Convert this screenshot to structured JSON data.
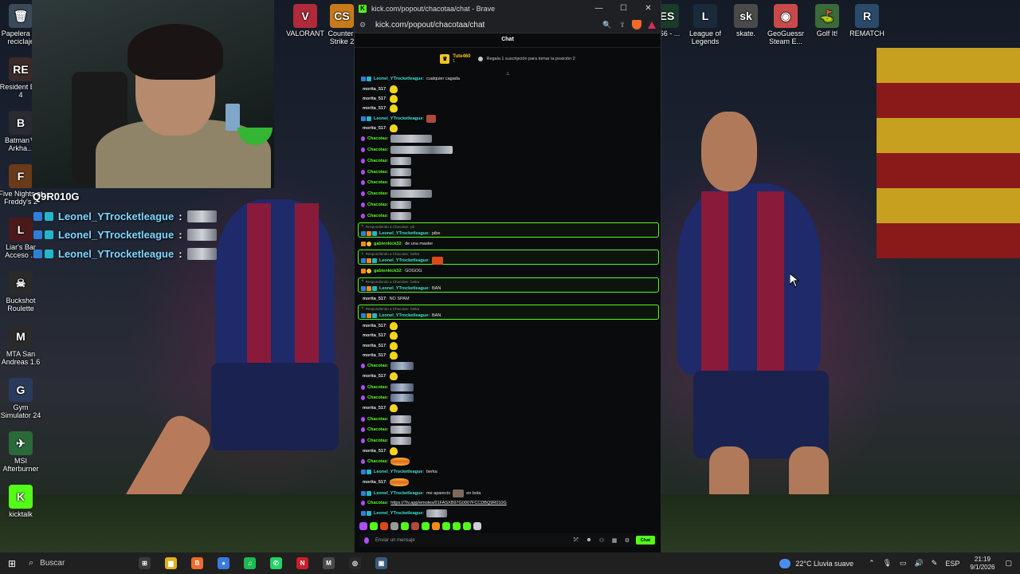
{
  "browser": {
    "title": "kick.com/popout/chacotaa/chat - Brave",
    "url": "kick.com/popout/chacotaa/chat",
    "window_buttons": [
      "—",
      "☐",
      "✕"
    ]
  },
  "chat": {
    "header": "Chat",
    "pinned": {
      "top_user": "Tute460",
      "top_count": "1",
      "info": "Regala 1 suscripción para tomar la posición 2"
    },
    "input_placeholder": "Enviar un mensaje",
    "send_label": "Chat",
    "reply_prefix": "Respondiendo a Chacotas:",
    "messages": [
      {
        "kind": "msg",
        "user": "Leonel_YTrocketleague",
        "badges": [
          "blue",
          "teal"
        ],
        "text": "cualquier cagada",
        "emote": ""
      },
      {
        "kind": "msg",
        "user": "morita_517",
        "badges": [],
        "text": "",
        "emote": "em-y"
      },
      {
        "kind": "msg",
        "user": "morita_517",
        "badges": [],
        "text": "",
        "emote": "em-y"
      },
      {
        "kind": "msg",
        "user": "morita_517",
        "badges": [],
        "text": "",
        "emote": "em-y"
      },
      {
        "kind": "msg",
        "user": "Leonel_YTrocketleague",
        "badges": [
          "blue",
          "teal"
        ],
        "text": "",
        "emote": "em-r"
      },
      {
        "kind": "msg",
        "user": "morita_517",
        "badges": [],
        "text": "",
        "emote": "em-y"
      },
      {
        "kind": "msg",
        "user": "Chacotas",
        "badges": [
          "purple"
        ],
        "text": "",
        "emote": "em-gm"
      },
      {
        "kind": "msg",
        "user": "Chacotas",
        "badges": [
          "purple"
        ],
        "text": "",
        "emote": "em-gw"
      },
      {
        "kind": "msg",
        "user": "Chacotas",
        "badges": [
          "purple"
        ],
        "text": "",
        "emote": "em-g"
      },
      {
        "kind": "msg",
        "user": "Chacotas",
        "badges": [
          "purple"
        ],
        "text": "",
        "emote": "em-g"
      },
      {
        "kind": "msg",
        "user": "Chacotas",
        "badges": [
          "purple"
        ],
        "text": "",
        "emote": "em-g"
      },
      {
        "kind": "msg",
        "user": "Chacotas",
        "badges": [
          "purple"
        ],
        "text": "",
        "emote": "em-gm"
      },
      {
        "kind": "msg",
        "user": "Chacotas",
        "badges": [
          "purple"
        ],
        "text": "",
        "emote": "em-g"
      },
      {
        "kind": "msg",
        "user": "Chacotas",
        "badges": [
          "purple"
        ],
        "text": "",
        "emote": "em-g"
      },
      {
        "kind": "reply",
        "ref": "pb",
        "user": "Leonel_YTrocketleague",
        "badges": [
          "blue",
          "orange",
          "teal"
        ],
        "text": "pibe",
        "emote": ""
      },
      {
        "kind": "msg",
        "user": "gabienkick32",
        "badges": [
          "orange",
          "yellow"
        ],
        "text": "de una master",
        "emote": ""
      },
      {
        "kind": "reply",
        "ref": "betka",
        "user": "Leonel_YTrocketleague",
        "badges": [
          "blue",
          "orange",
          "teal"
        ],
        "text": "",
        "emote": "em-fire"
      },
      {
        "kind": "msg",
        "user": "gabienkick32",
        "badges": [
          "orange",
          "yellow"
        ],
        "text": "GOGOG",
        "emote": ""
      },
      {
        "kind": "reply",
        "ref": "betka",
        "user": "Leonel_YTrocketleague",
        "badges": [
          "blue",
          "orange",
          "teal"
        ],
        "text": "BAN",
        "emote": ""
      },
      {
        "kind": "msg",
        "user": "morita_517",
        "badges": [],
        "text": "NO SPAM",
        "emote": ""
      },
      {
        "kind": "reply",
        "ref": "betka",
        "user": "Leonel_YTrocketleague",
        "badges": [
          "blue",
          "orange",
          "teal"
        ],
        "text": "BAN",
        "emote": ""
      },
      {
        "kind": "msg",
        "user": "morita_517",
        "badges": [],
        "text": "",
        "emote": "em-y"
      },
      {
        "kind": "msg",
        "user": "morita_517",
        "badges": [],
        "text": "",
        "emote": "em-y"
      },
      {
        "kind": "msg",
        "user": "morita_517",
        "badges": [],
        "text": "",
        "emote": "em-y"
      },
      {
        "kind": "msg",
        "user": "morita_517",
        "badges": [],
        "text": "",
        "emote": "em-y"
      },
      {
        "kind": "msg",
        "user": "Chacotas",
        "badges": [
          "purple"
        ],
        "text": "",
        "emote": "em-b"
      },
      {
        "kind": "msg",
        "user": "morita_517",
        "badges": [],
        "text": "",
        "emote": "em-y"
      },
      {
        "kind": "msg",
        "user": "Chacotas",
        "badges": [
          "purple"
        ],
        "text": "",
        "emote": "em-b"
      },
      {
        "kind": "msg",
        "user": "Chacotas",
        "badges": [
          "purple"
        ],
        "text": "",
        "emote": "em-b"
      },
      {
        "kind": "msg",
        "user": "morita_517",
        "badges": [],
        "text": "",
        "emote": "em-y"
      },
      {
        "kind": "msg",
        "user": "Chacotas",
        "badges": [
          "purple"
        ],
        "text": "",
        "emote": "em-g"
      },
      {
        "kind": "msg",
        "user": "Chacotas",
        "badges": [
          "purple"
        ],
        "text": "",
        "emote": "em-g"
      },
      {
        "kind": "msg",
        "user": "Chacotas",
        "badges": [
          "purple"
        ],
        "text": "",
        "emote": "em-g"
      },
      {
        "kind": "msg",
        "user": "morita_517",
        "badges": [],
        "text": "",
        "emote": "em-y"
      },
      {
        "kind": "msg",
        "user": "Chacotas",
        "badges": [
          "purple"
        ],
        "text": "",
        "emote": "em-burger"
      },
      {
        "kind": "msg",
        "user": "Leonel_YTrocketleague",
        "badges": [
          "blue",
          "teal"
        ],
        "text": "berka",
        "emote": ""
      },
      {
        "kind": "msg",
        "user": "morita_517",
        "badges": [],
        "text": "",
        "emote": "em-burger"
      },
      {
        "kind": "msg",
        "user": "Leonel_YTrocketleague",
        "badges": [
          "blue",
          "teal"
        ],
        "text": "me aparecio",
        "emote": "em-cat",
        "text2": "en bola"
      },
      {
        "kind": "msg",
        "user": "Chacotas",
        "badges": [
          "purple"
        ],
        "text": "",
        "emote": "",
        "link": "https://7tv.app/emotes/01FASXB97G0007FCCDBQ9R010G"
      },
      {
        "kind": "msg",
        "user": "Leonel_YTrocketleague",
        "badges": [
          "blue",
          "teal"
        ],
        "text": "",
        "emote": "em-g"
      },
      {
        "kind": "msg",
        "user": "Leonel_YTrocketleague",
        "badges": [
          "blue",
          "teal"
        ],
        "text": "",
        "emote": "em-g"
      },
      {
        "kind": "msg",
        "user": "Leonel_YTrocketleague",
        "badges": [
          "blue",
          "teal"
        ],
        "text": "",
        "emote": "em-g"
      }
    ],
    "emote_bar_colors": [
      "#b14cff",
      "#53fc18",
      "#d94a1a",
      "#9a9a9a",
      "#53fc18",
      "#b04a3a",
      "#53fc18",
      "#f28a1a",
      "#53fc18",
      "#53fc18",
      "#53fc18",
      "#cfcfcf"
    ]
  },
  "overlay": {
    "name": "Q9R010G",
    "lines": [
      {
        "user": "Leonel_YTrocketleague",
        "colon": ":"
      },
      {
        "user": "Leonel_YTrocketleague",
        "colon": ":"
      },
      {
        "user": "Leonel_YTrocketleague",
        "colon": ":"
      }
    ]
  },
  "desktop_icons": [
    {
      "label": "Papelera de reciclaje",
      "glyph": "🗑",
      "color": "#3a4a5a",
      "col": 0,
      "row": 0
    },
    {
      "label": "Resident Evil 4",
      "glyph": "RE",
      "color": "#3a2a2a",
      "col": 0,
      "row": 1
    },
    {
      "label": "Batman™ Arkha...",
      "glyph": "B",
      "color": "#2a2a33",
      "col": 0,
      "row": 2
    },
    {
      "label": "Five Nights at Freddy's 2",
      "glyph": "F",
      "color": "#6a3a1a",
      "col": 0,
      "row": 3
    },
    {
      "label": "Liar's Bar Acceso ...",
      "glyph": "L",
      "color": "#4a1a1a",
      "col": 0,
      "row": 4
    },
    {
      "label": "Buckshot Roulette",
      "glyph": "☠",
      "color": "#2a2a2a",
      "col": 0,
      "row": 5
    },
    {
      "label": "MTA San Andreas 1.6",
      "glyph": "M",
      "color": "#2a2a2a",
      "col": 0,
      "row": 6
    },
    {
      "label": "Gym Simulator 24",
      "glyph": "G",
      "color": "#2a3a5a",
      "col": 0,
      "row": 7
    },
    {
      "label": "MSI Afterburner",
      "glyph": "✈",
      "color": "#2a6a3a",
      "col": 0,
      "row": 8
    },
    {
      "label": "kicktalk",
      "glyph": "K",
      "color": "#53fc18",
      "col": 0,
      "row": 9
    },
    {
      "label": "VALORANT",
      "glyph": "V",
      "color": "#b02a3a",
      "col": 1,
      "row": 0
    },
    {
      "label": "Counter-Strike 2",
      "glyph": "CS",
      "color": "#c87a1a",
      "col": 2,
      "row": 0
    },
    {
      "label": "ES6 - ...",
      "glyph": "ES",
      "color": "#1a3a2a",
      "col": 3,
      "row": 0
    },
    {
      "label": "League of Legends",
      "glyph": "L",
      "color": "#1a2a3a",
      "col": 4,
      "row": 0
    },
    {
      "label": "skate.",
      "glyph": "sk",
      "color": "#4a4a4a",
      "col": 5,
      "row": 0
    },
    {
      "label": "GeoGuessr Steam E...",
      "glyph": "◉",
      "color": "#c84a4a",
      "col": 6,
      "row": 0
    },
    {
      "label": "Golf It!",
      "glyph": "⛳",
      "color": "#3a6a3a",
      "col": 7,
      "row": 0
    },
    {
      "label": "REMATCH",
      "glyph": "R",
      "color": "#2a4a6a",
      "col": 8,
      "row": 0
    }
  ],
  "taskbar": {
    "search_placeholder": "Buscar",
    "apps": [
      {
        "name": "task-view",
        "color": "#3a3a3a",
        "glyph": "⊞"
      },
      {
        "name": "file-explorer",
        "color": "#e0b020",
        "glyph": "▆"
      },
      {
        "name": "brave",
        "color": "#f06a2a",
        "glyph": "B"
      },
      {
        "name": "chrome",
        "color": "#3a7ae0",
        "glyph": "●"
      },
      {
        "name": "spotify",
        "color": "#1db954",
        "glyph": "♫"
      },
      {
        "name": "whatsapp",
        "color": "#25d366",
        "glyph": "✆"
      },
      {
        "name": "news",
        "color": "#c8202a",
        "glyph": "N"
      },
      {
        "name": "media",
        "color": "#4a4a4a",
        "glyph": "M"
      },
      {
        "name": "obs",
        "color": "#2a2a2a",
        "glyph": "◎"
      },
      {
        "name": "app",
        "color": "#3a5a7a",
        "glyph": "▣"
      }
    ],
    "weather": "22°C  Lluvia suave",
    "language": "ESP",
    "time": "21:19",
    "date": "9/1/2026"
  }
}
